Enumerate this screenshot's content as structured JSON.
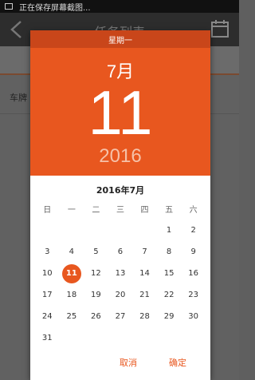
{
  "status_bar": {
    "text": "正在保存屏幕截图..."
  },
  "toolbar": {
    "title": "任务列表",
    "back_icon": "back-arrow-icon",
    "calendar_icon": "calendar-icon"
  },
  "background": {
    "plate_label": "车牌"
  },
  "dialog": {
    "weekday": "星期一",
    "month": "7月",
    "day": "11",
    "year": "2016",
    "month_title": "2016年7月",
    "weekday_headers": [
      "日",
      "一",
      "二",
      "三",
      "四",
      "五",
      "六"
    ],
    "weeks": [
      [
        "",
        "",
        "",
        "",
        "",
        "1",
        "2"
      ],
      [
        "3",
        "4",
        "5",
        "6",
        "7",
        "8",
        "9"
      ],
      [
        "10",
        "11",
        "12",
        "13",
        "14",
        "15",
        "16"
      ],
      [
        "17",
        "18",
        "19",
        "20",
        "21",
        "22",
        "23"
      ],
      [
        "24",
        "25",
        "26",
        "27",
        "28",
        "29",
        "30"
      ],
      [
        "31",
        "",
        "",
        "",
        "",
        "",
        ""
      ]
    ],
    "selected_day": "11",
    "cancel_label": "取消",
    "ok_label": "确定",
    "accent_color": "#e8571f",
    "header_dark_color": "#c9461a"
  }
}
